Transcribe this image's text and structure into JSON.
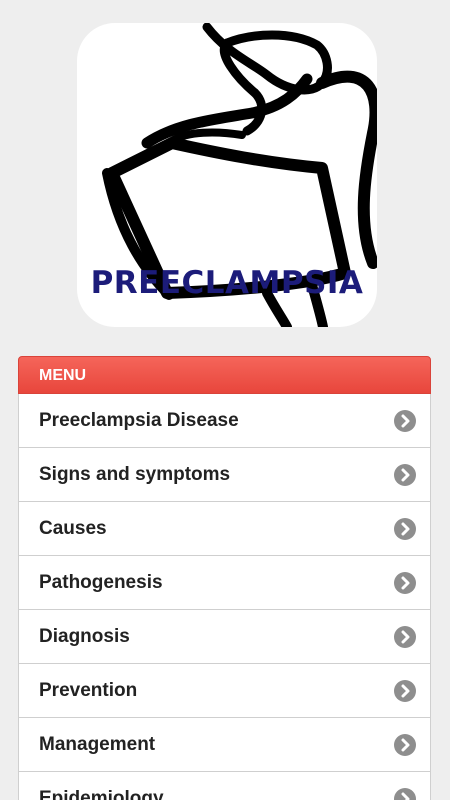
{
  "logo": {
    "title": "PREECLAMPSIA",
    "icon": "pregnant-woman-silhouette"
  },
  "menu": {
    "header": "MENU",
    "items": [
      {
        "label": "Preeclampsia Disease"
      },
      {
        "label": "Signs and symptoms"
      },
      {
        "label": "Causes"
      },
      {
        "label": "Pathogenesis"
      },
      {
        "label": "Diagnosis"
      },
      {
        "label": "Prevention"
      },
      {
        "label": "Management"
      },
      {
        "label": "Epidemiology"
      }
    ]
  },
  "colors": {
    "header_bg": "#f15a4f",
    "logo_text": "#1c1c7a",
    "chevron_bg": "#8e8e8e"
  }
}
